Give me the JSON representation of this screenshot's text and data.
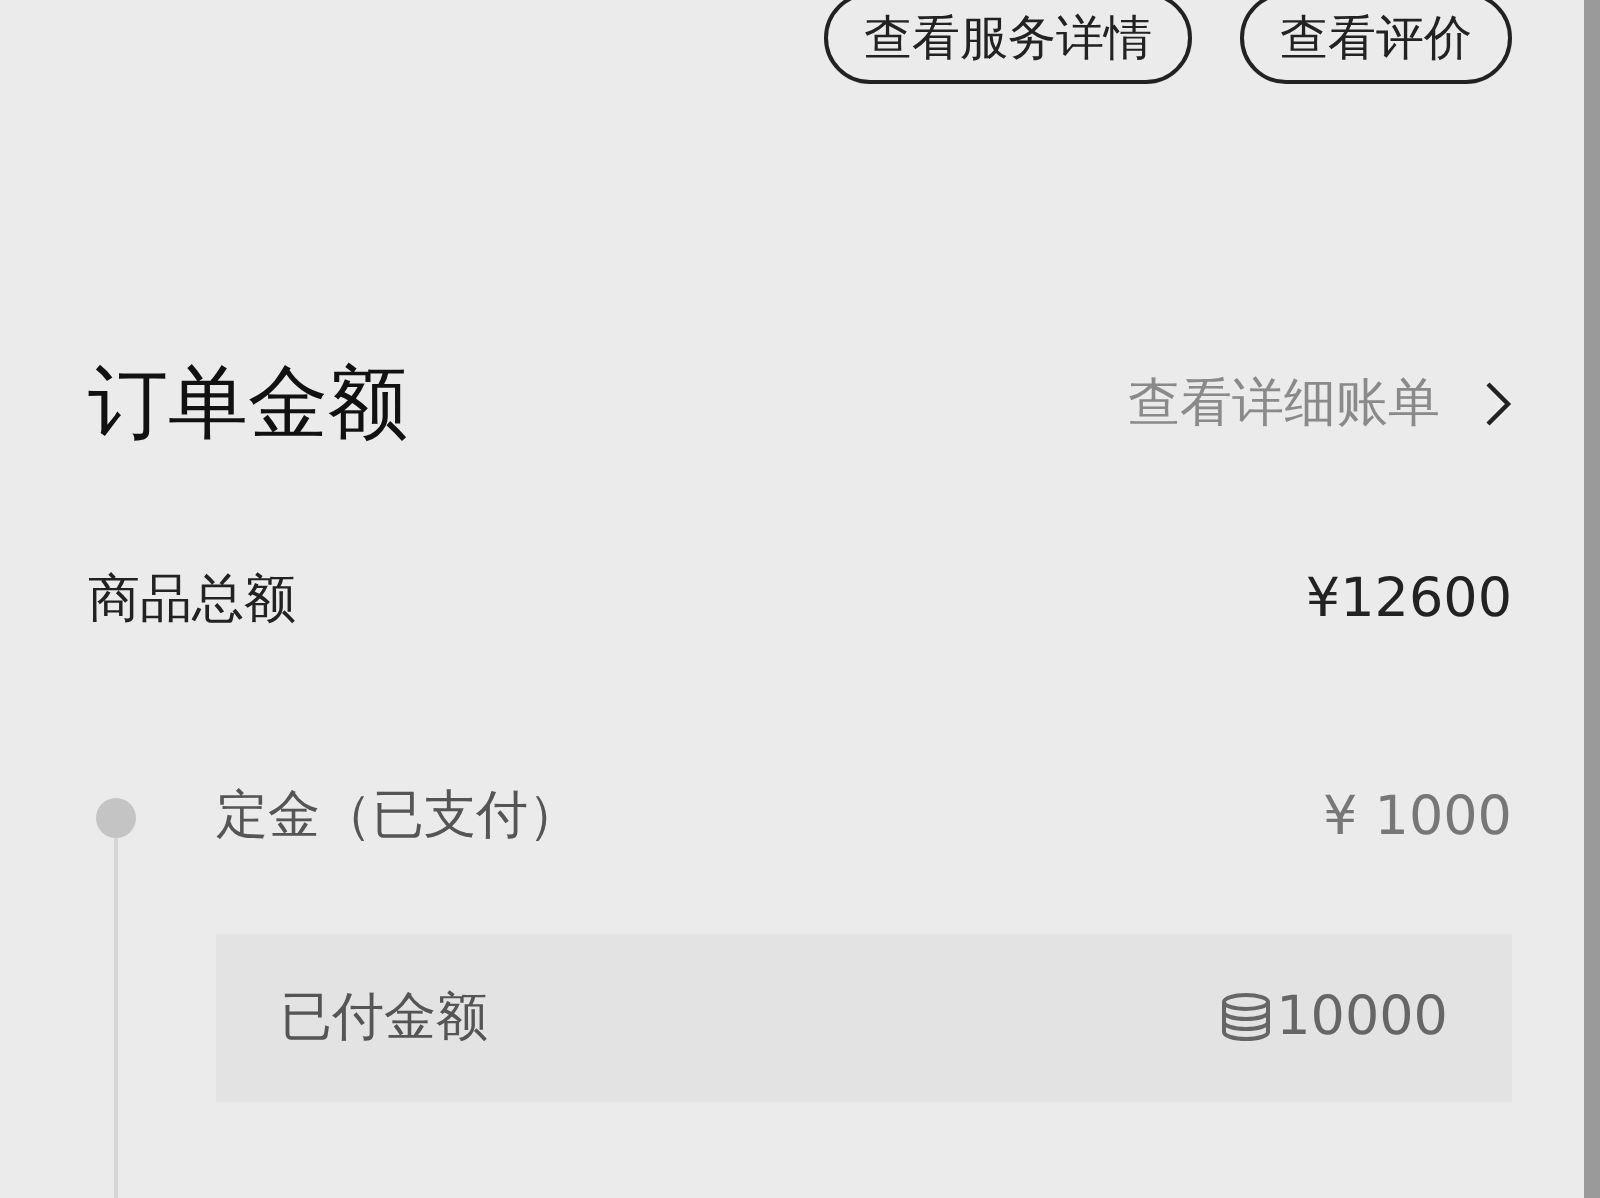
{
  "actions": [
    "查看服务详情",
    "查看评价"
  ],
  "order_amount": {
    "title": "订单金额",
    "link": "查看详细账单",
    "total_label": "商品总额",
    "total_value": "¥12600"
  },
  "timeline": [
    {
      "label": "定金（已支付）",
      "value": "¥ 1000",
      "detail": {
        "label": "已付金额",
        "value": "10000"
      }
    }
  ]
}
